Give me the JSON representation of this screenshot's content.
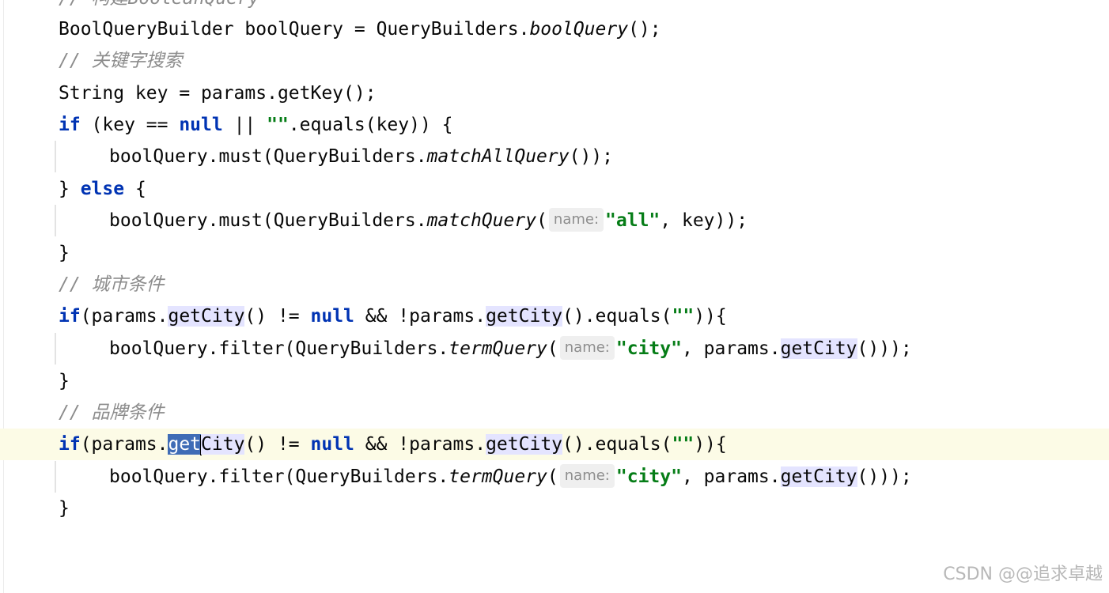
{
  "editor": {
    "line0_comment": "// 构建BooleanQuery",
    "line1": {
      "type": "BoolQueryBuilder",
      "var": " boolQuery = QueryBuilders.",
      "method": "boolQuery",
      "tail": "();"
    },
    "line2_comment": "// 关键字搜索",
    "line3": "String key = params.getKey();",
    "line4": {
      "if_kw": "if",
      "a": " (key == ",
      "null_kw": "null",
      "b": " || ",
      "str": "\"\"",
      "c": ".equals(key)) {"
    },
    "line5": {
      "a": "boolQuery.must(QueryBuilders.",
      "method": "matchAllQuery",
      "b": "());"
    },
    "line6": {
      "a": "} ",
      "else_kw": "else",
      "b": " {"
    },
    "line7": {
      "a": "boolQuery.must(QueryBuilders.",
      "method": "matchQuery",
      "b": "(",
      "hint": "name:",
      "str": "\"all\"",
      "c": ", key));"
    },
    "line8": "}",
    "line9_comment": "// 城市条件",
    "line10": {
      "if_kw": "if",
      "a": "(params.",
      "get1": "getCity",
      "b": "() != ",
      "null_kw": "null",
      "c": " && !params.",
      "get2": "getCity",
      "d": "().equals(",
      "str": "\"\"",
      "e": ")){"
    },
    "line11": {
      "a": "boolQuery.filter(QueryBuilders.",
      "method": "termQuery",
      "b": "(",
      "hint": "name:",
      "str": "\"city\"",
      "c": ", params.",
      "get": "getCity",
      "d": "()));"
    },
    "line12": "}",
    "line13_comment": "// 品牌条件",
    "line14": {
      "if_kw": "if",
      "a": "(params.",
      "sel": "get",
      "get1_rest": "City",
      "b": "() != ",
      "null_kw": "null",
      "c": " && !params.",
      "get2": "getCity",
      "d": "().equals(",
      "str": "\"\"",
      "e": ")){"
    },
    "line15": {
      "a": "boolQuery.filter(QueryBuilders.",
      "method": "termQuery",
      "b": "(",
      "hint": "name:",
      "str": "\"city\"",
      "c": ", params.",
      "get": "getCity",
      "d": "()));"
    },
    "line16": "}"
  },
  "watermark": "CSDN @@追求卓越",
  "colors": {
    "keyword": "#0033b3",
    "string": "#067d17",
    "comment": "#8c8c8c",
    "usage_highlight": "#e4e4ff",
    "selection": "#3f6cb6",
    "current_line": "#fcfbe6"
  }
}
